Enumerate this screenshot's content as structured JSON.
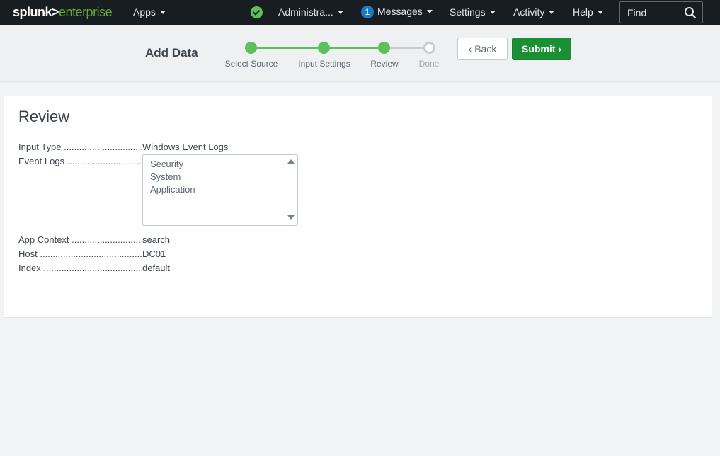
{
  "topbar": {
    "brand_main": "splunk>",
    "brand_sub": "enterprise",
    "apps": "Apps",
    "user": "Administra...",
    "messages_count": "1",
    "messages": "Messages",
    "settings": "Settings",
    "activity": "Activity",
    "help": "Help",
    "find_placeholder": "Find"
  },
  "wizard": {
    "title": "Add Data",
    "steps": [
      {
        "label": "Select Source",
        "state": "complete"
      },
      {
        "label": "Input Settings",
        "state": "complete"
      },
      {
        "label": "Review",
        "state": "current"
      },
      {
        "label": "Done",
        "state": "pending"
      }
    ],
    "back_label": "Back",
    "submit_label": "Submit"
  },
  "review": {
    "title": "Review",
    "input_type_label": "Input Type",
    "input_type_value": "Windows Event Logs",
    "event_logs_label": "Event Logs",
    "event_logs": [
      "Security",
      "System",
      "Application"
    ],
    "app_context_label": "App Context",
    "app_context_value": "search",
    "host_label": "Host",
    "host_value": "DC01",
    "index_label": "Index",
    "index_value": "default"
  },
  "colors": {
    "accent_green": "#5cc05c",
    "submit_green": "#1a9035",
    "nav_bg": "#171d21",
    "badge_blue": "#1a7bc4"
  }
}
